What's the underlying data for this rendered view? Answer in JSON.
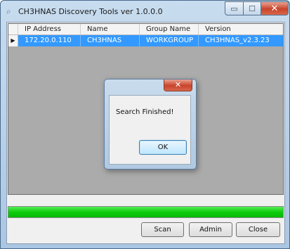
{
  "window": {
    "app_icon": "search-magnifier-icon",
    "title": "CH3HNAS Discovery Tools   ver 1.0.0.0",
    "min_glyph": "▭",
    "max_glyph": "☐",
    "close_glyph": "✕"
  },
  "grid": {
    "columns": [
      "IP Address",
      "Name",
      "Group Name",
      "Version"
    ],
    "rows": [
      {
        "indicator": "▶",
        "ip": "172.20.0.110",
        "name": "CH3HNAS",
        "group": "WORKGROUP",
        "version": "CH3HNAS_v2.3.23",
        "selected": true
      }
    ]
  },
  "progress": {
    "value": 100,
    "color": "#0dcc0d"
  },
  "buttons": {
    "scan": "Scan",
    "admin": "Admin",
    "close": "Close"
  },
  "dialog": {
    "message": "Search Finished!",
    "ok": "OK",
    "close_glyph": "✕"
  }
}
